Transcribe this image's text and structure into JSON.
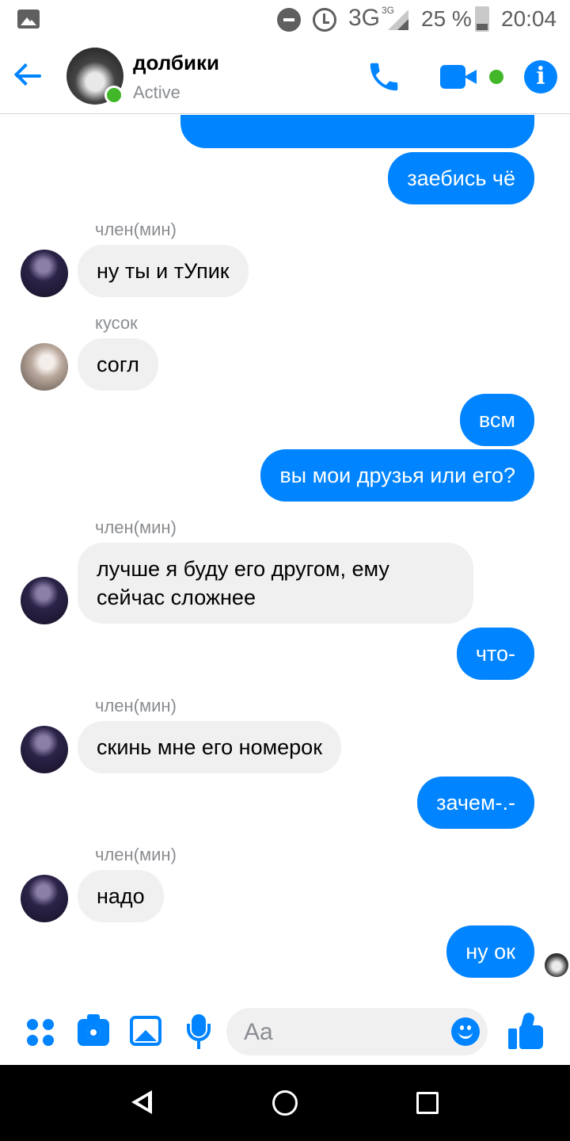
{
  "status_bar": {
    "network": "3G",
    "network_small": "3G",
    "battery": "25 %",
    "time": "20:04"
  },
  "header": {
    "title": "долбики",
    "status": "Active",
    "icons": [
      "back-arrow-icon",
      "phone-icon",
      "video-camera-icon",
      "info-icon"
    ]
  },
  "messages": [
    {
      "direction": "out",
      "text": "заебись чё"
    },
    {
      "direction": "in",
      "sender": "член(мин)",
      "text": "ну ты и тУпик"
    },
    {
      "direction": "in",
      "sender": "кусок",
      "text": "согл"
    },
    {
      "direction": "out",
      "text": "всм"
    },
    {
      "direction": "out",
      "text": "вы мои друзья или его?"
    },
    {
      "direction": "in",
      "sender": "член(мин)",
      "text": "лучше я буду его другом, ему сейчас сложнее"
    },
    {
      "direction": "out",
      "text": "что-"
    },
    {
      "direction": "in",
      "sender": "член(мин)",
      "text": "скинь мне его номерок"
    },
    {
      "direction": "out",
      "text": "зачем-.-"
    },
    {
      "direction": "in",
      "sender": "член(мин)",
      "text": "надо"
    },
    {
      "direction": "out",
      "text": "ну ок"
    }
  ],
  "composer": {
    "placeholder": "Aa",
    "icons": [
      "more-icon",
      "camera-icon",
      "gallery-icon",
      "microphone-icon",
      "emoji-icon",
      "thumbs-up-icon"
    ]
  },
  "colors": {
    "accent": "#0084ff",
    "incoming_bubble": "#f0f0f0",
    "online": "#42b72a",
    "secondary_text": "#8a8d91"
  }
}
